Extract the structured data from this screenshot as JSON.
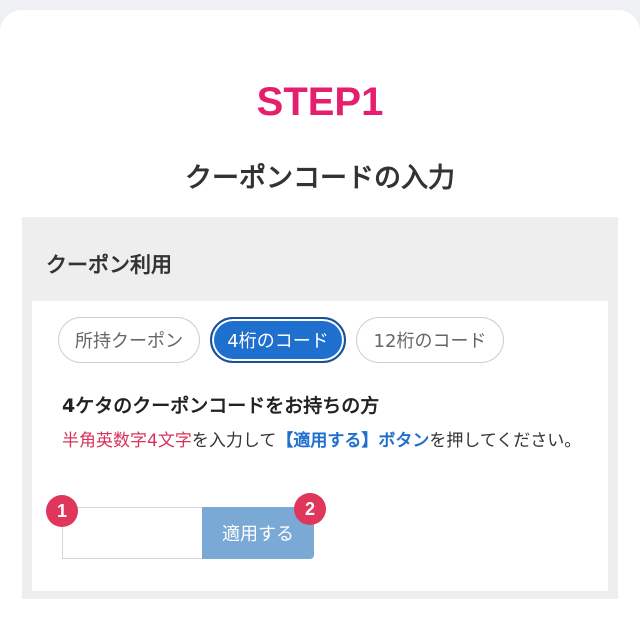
{
  "step": {
    "title": "STEP1",
    "subtitle": "クーポンコードの入力"
  },
  "panel": {
    "title": "クーポン利用",
    "tabs": [
      {
        "label": "所持クーポン",
        "active": false
      },
      {
        "label": "4桁のコード",
        "active": true
      },
      {
        "label": "12桁のコード",
        "active": false
      }
    ],
    "heading": "4ケタのクーポンコードをお持ちの方",
    "description": {
      "highlight": "半角英数字4文字",
      "middle": "を入力して",
      "button_ref": "【適用する】ボタン",
      "end": "を押してください。"
    },
    "input": {
      "value": "",
      "placeholder": ""
    },
    "apply_label": "適用する",
    "badges": [
      "1",
      "2"
    ]
  },
  "colors": {
    "accent_pink": "#e61e6e",
    "active_tab": "#1f6fcf",
    "apply_button": "#79a9d4",
    "badge": "#e0365b",
    "highlight_red": "#d8345a"
  }
}
